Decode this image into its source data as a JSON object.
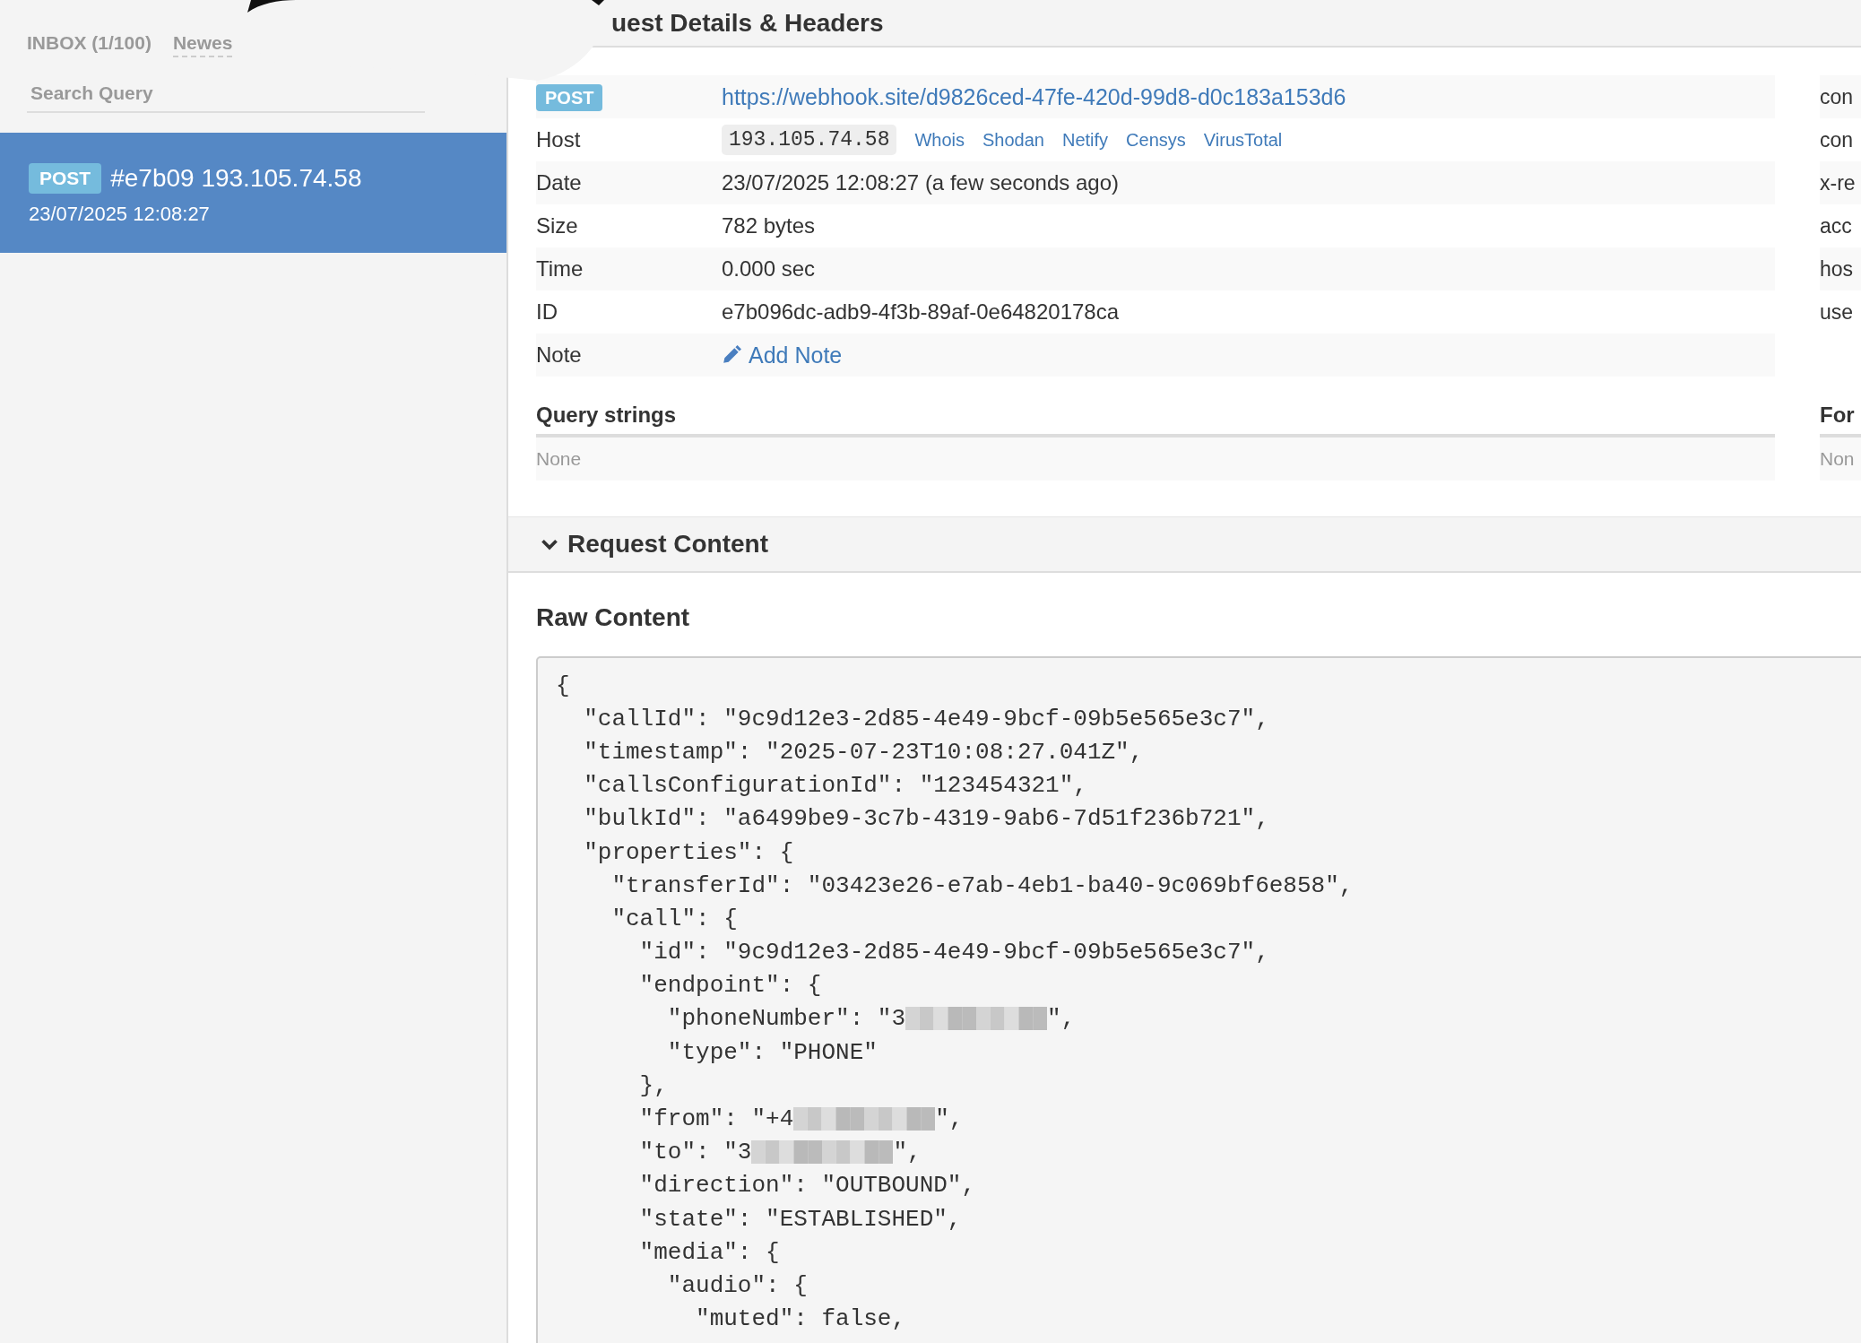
{
  "sidebar": {
    "inbox_label": "INBOX (1/100)",
    "sort": "Newes",
    "search": {
      "placeholder": "Search Query"
    },
    "requests": [
      {
        "method": "POST",
        "title": "#e7b09 193.105.74.58",
        "date": "23/07/2025 12:08:27",
        "selected": true
      }
    ]
  },
  "details": {
    "title": "uest Details & Headers",
    "method": "POST",
    "url": "https://webhook.site/d9826ced-47fe-420d-99d8-d0c183a153d6",
    "rows": [
      {
        "label": "Host",
        "kind": "host",
        "value": "193.105.74.58",
        "links": [
          "Whois",
          "Shodan",
          "Netify",
          "Censys",
          "VirusTotal"
        ]
      },
      {
        "label": "Date",
        "kind": "text",
        "value": "23/07/2025 12:08:27 (a few seconds ago)"
      },
      {
        "label": "Size",
        "kind": "text",
        "value": "782 bytes"
      },
      {
        "label": "Time",
        "kind": "text",
        "value": "0.000 sec"
      },
      {
        "label": "ID",
        "kind": "text",
        "value": "e7b096dc-adb9-4f3b-89af-0e64820178ca"
      },
      {
        "label": "Note",
        "kind": "action",
        "value": "Add Note"
      }
    ],
    "query_strings": {
      "title": "Query strings",
      "empty": "None"
    }
  },
  "headers_column": {
    "rows": [
      "con",
      "con",
      "x-re",
      "acc",
      "hos",
      "use"
    ],
    "form_title": "For",
    "form_empty": "Non"
  },
  "request_content": {
    "title": "Request Content",
    "expanded": true,
    "raw_title": "Raw Content",
    "lines": [
      {
        "text": "{"
      },
      {
        "text": "  \"callId\": \"9c9d12e3-2d85-4e49-9bcf-09b5e565e3c7\","
      },
      {
        "text": "  \"timestamp\": \"2025-07-23T10:08:27.041Z\","
      },
      {
        "text": "  \"callsConfigurationId\": \"123454321\","
      },
      {
        "text": "  \"bulkId\": \"a6499be9-3c7b-4319-9ab6-7d51f236b721\","
      },
      {
        "text": "  \"properties\": {"
      },
      {
        "text": "    \"transferId\": \"03423e26-e7ab-4eb1-ba40-9c069bf6e858\","
      },
      {
        "text": "    \"call\": {"
      },
      {
        "text": "      \"id\": \"9c9d12e3-2d85-4e49-9bcf-09b5e565e3c7\","
      },
      {
        "text": "      \"endpoint\": {"
      },
      {
        "text": "        \"phoneNumber\": \"3",
        "kind": "redacted",
        "after": "\","
      },
      {
        "text": "        \"type\": \"PHONE\""
      },
      {
        "text": "      },"
      },
      {
        "text": "      \"from\": \"+4",
        "kind": "redacted",
        "after": "\","
      },
      {
        "text": "      \"to\": \"3",
        "kind": "redacted",
        "after": "\","
      },
      {
        "text": "      \"direction\": \"OUTBOUND\","
      },
      {
        "text": "      \"state\": \"ESTABLISHED\","
      },
      {
        "text": "      \"media\": {"
      },
      {
        "text": "        \"audio\": {"
      },
      {
        "text": "          \"muted\": false,"
      }
    ]
  }
}
